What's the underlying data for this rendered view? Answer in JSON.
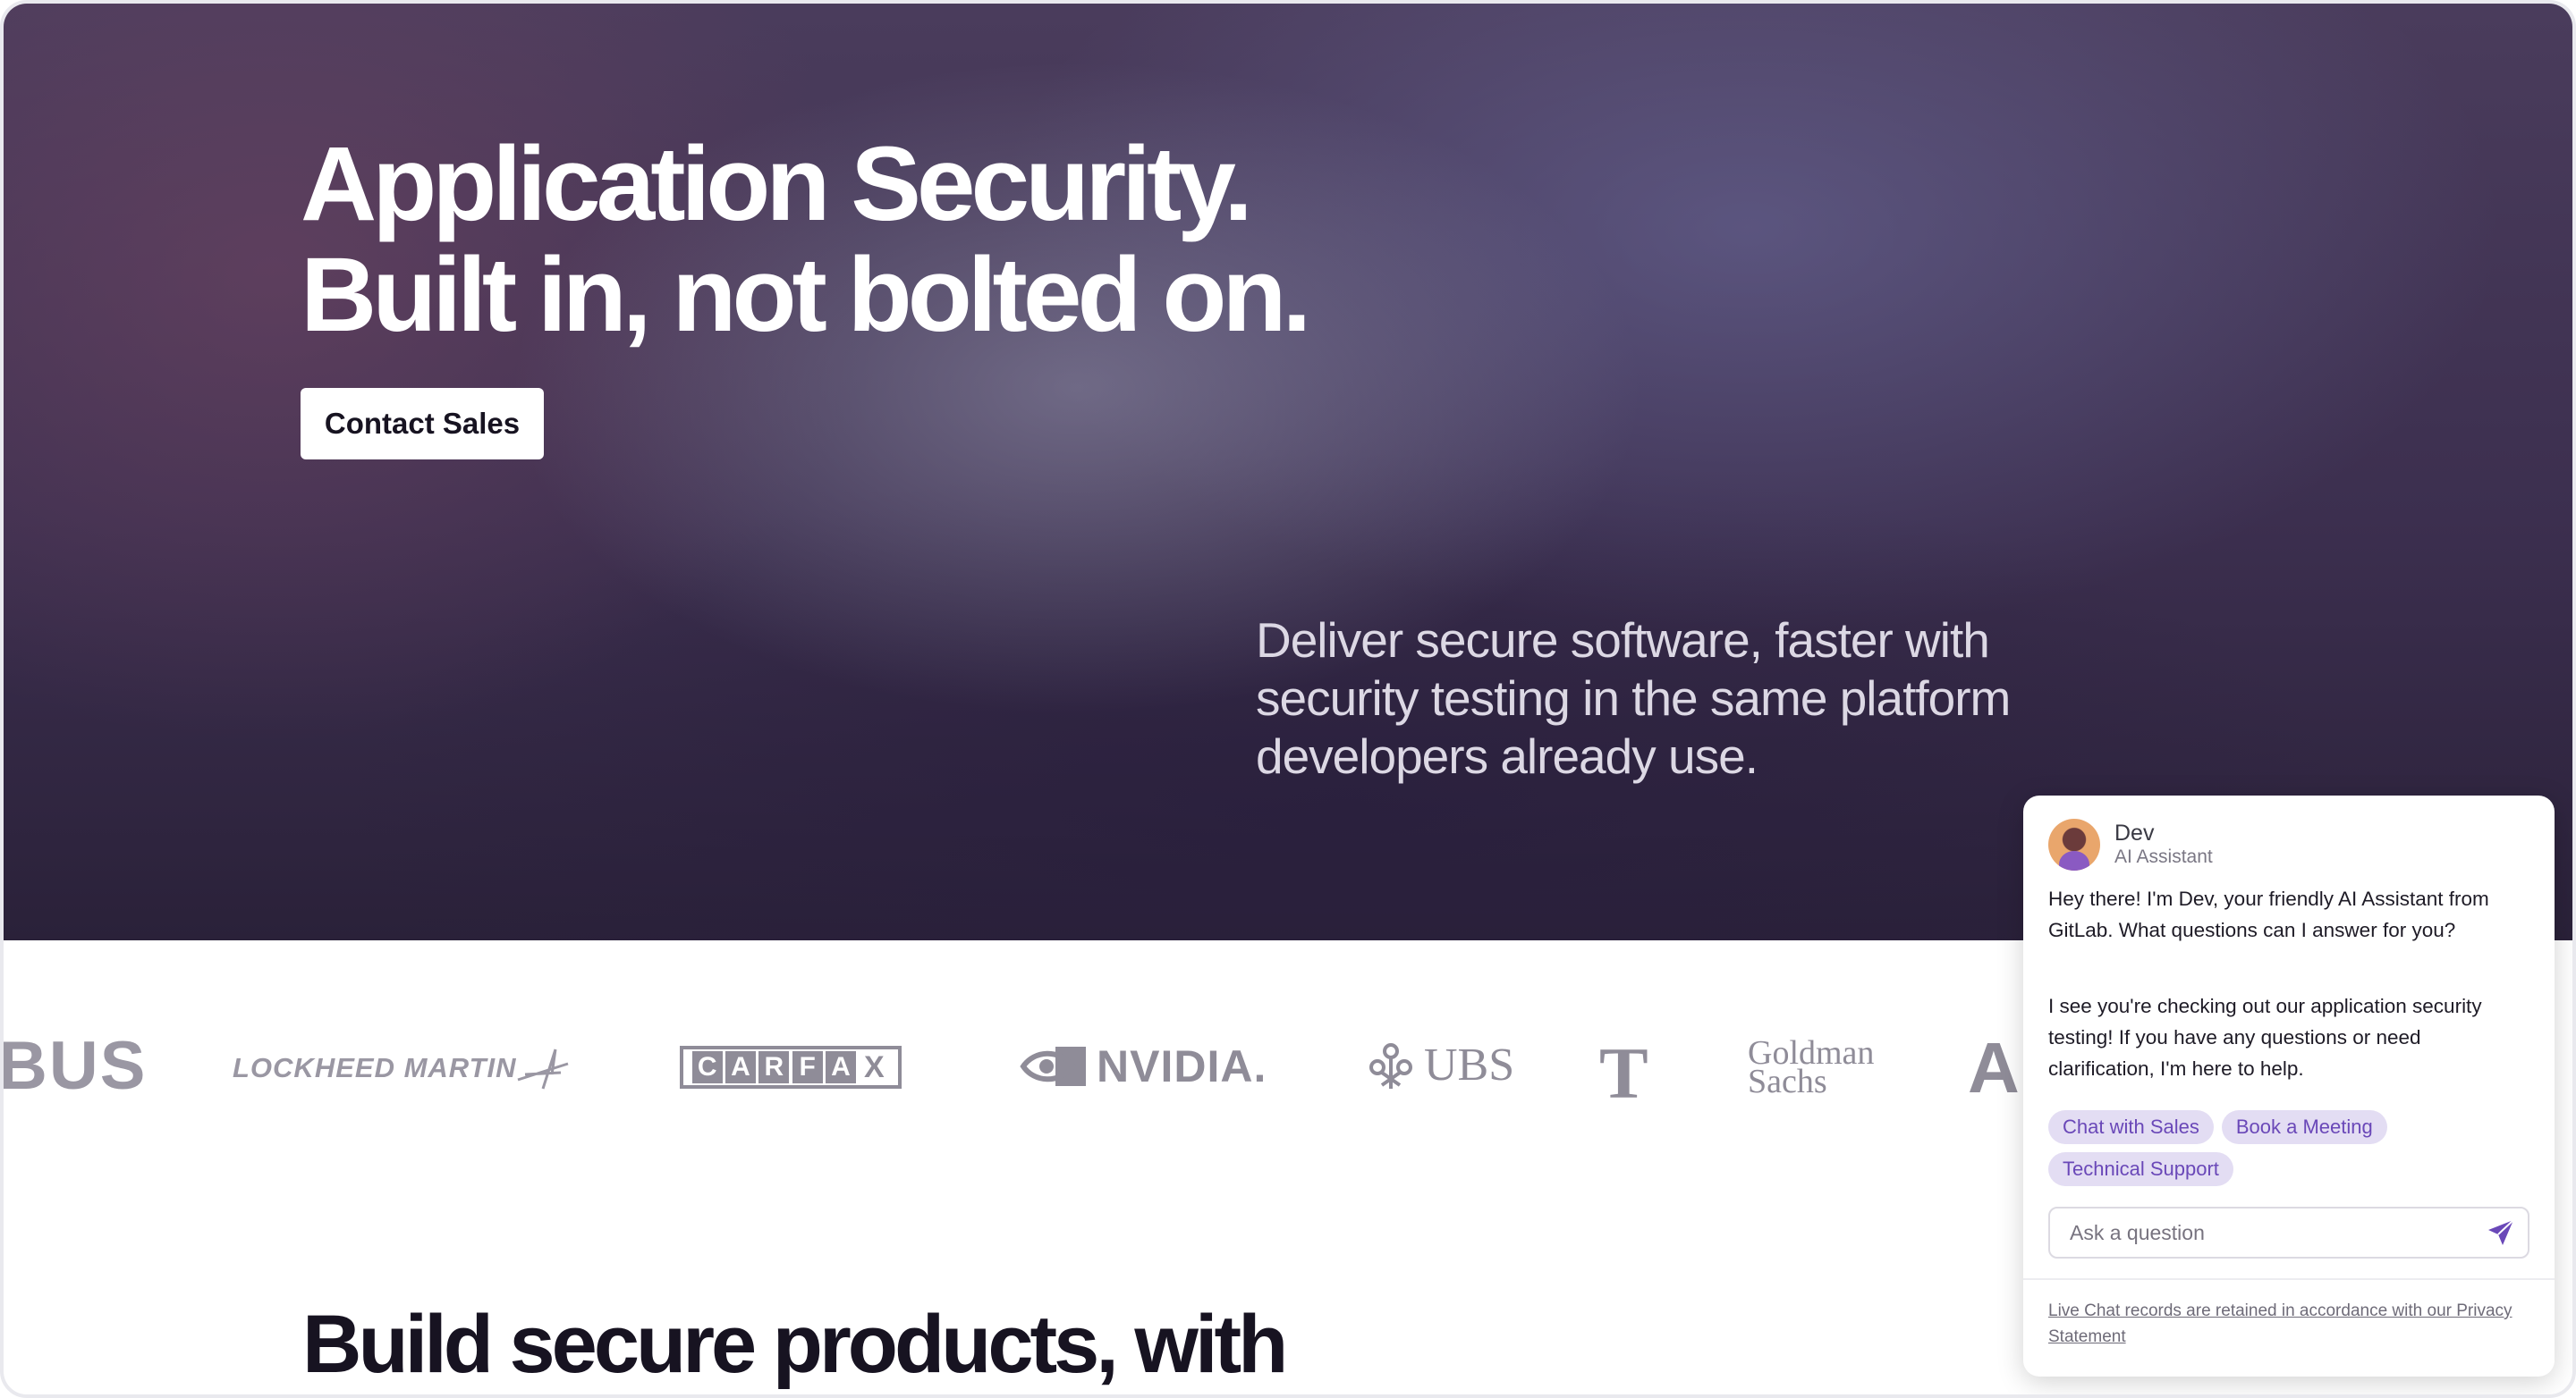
{
  "hero": {
    "title_line1": "Application Security.",
    "title_line2": "Built in, not bolted on.",
    "cta_label": "Contact Sales",
    "subtitle": "Deliver secure software, faster with security testing in the same platform developers already use."
  },
  "logos": {
    "airbus_partial": "BUS",
    "lockheed": "LOCKHEED MARTIN",
    "carfax_letters": [
      "C",
      "A",
      "R",
      "F",
      "A",
      "X"
    ],
    "nvidia": "NVIDIA.",
    "ubs": "UBS",
    "telekom": "T",
    "goldman_line1": "Goldman",
    "goldman_line2": "Sachs",
    "partial_next": "A"
  },
  "section": {
    "title": "Build secure products, with"
  },
  "chat": {
    "agent_name": "Dev",
    "agent_role": "AI Assistant",
    "message1": "Hey there! I'm Dev, your friendly AI Assistant from GitLab. What questions can I answer for you?",
    "message2": "I see you're checking out our application security testing! If you have any questions or need clarification, I'm here to help.",
    "chips": [
      "Chat with Sales",
      "Book a Meeting",
      "Technical Support"
    ],
    "input_placeholder": "Ask a question",
    "footer": "Live Chat records are retained in accordance with our Privacy Statement",
    "accent_color": "#6a48b8"
  }
}
